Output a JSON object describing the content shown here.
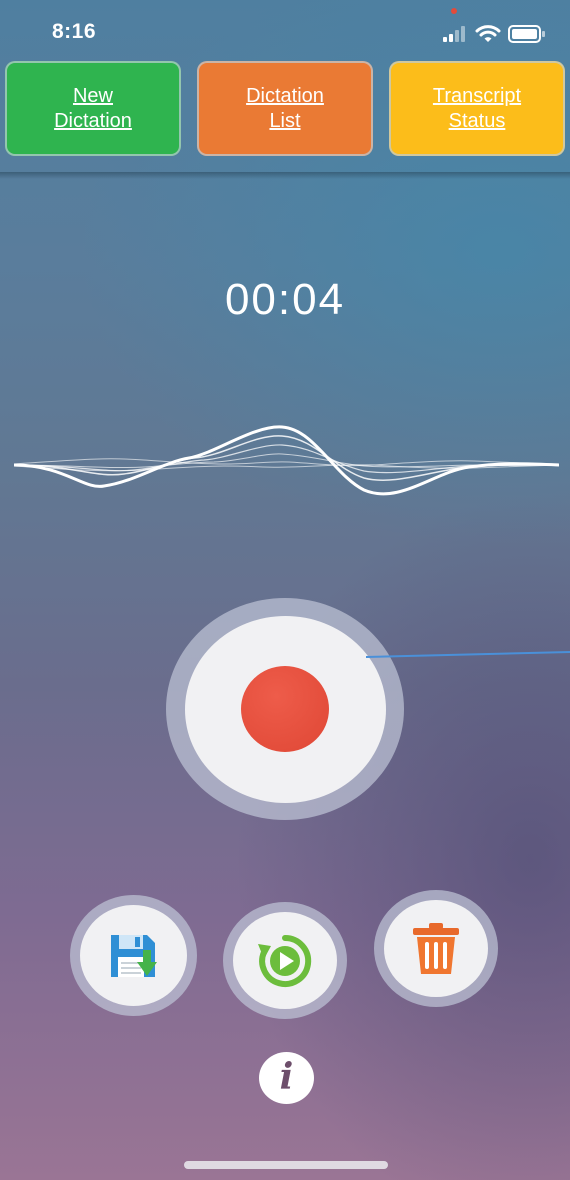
{
  "status_bar": {
    "time": "8:16",
    "recording_indicator_color": "#e34b3a",
    "icons": [
      "cellular-signal-icon",
      "wifi-icon",
      "battery-icon"
    ]
  },
  "nav": {
    "buttons": [
      {
        "label": "New\nDictation",
        "color": "#2fb44f"
      },
      {
        "label": "Dictation\nList",
        "color": "#ea7a34"
      },
      {
        "label": "Transcript\nStatus",
        "color": "#fcbd1a"
      }
    ]
  },
  "recorder": {
    "timer": "00:04",
    "record_color": "#e34b3a",
    "pointer_line_color": "#4a90d9"
  },
  "actions": {
    "icons": [
      "save-icon",
      "replay-icon",
      "trash-icon"
    ]
  },
  "info": {
    "glyph": "i"
  }
}
